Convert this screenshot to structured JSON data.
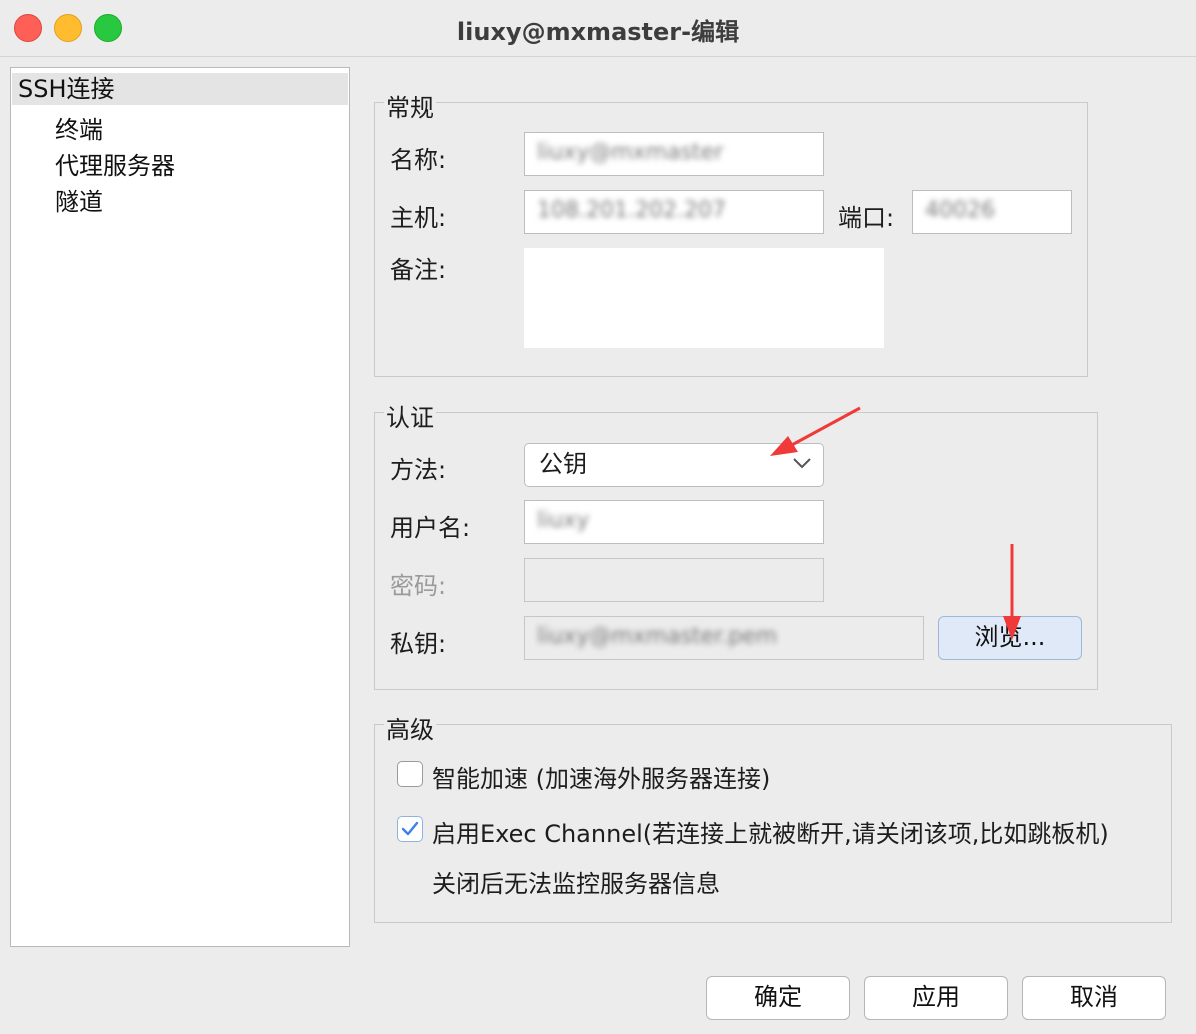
{
  "window": {
    "title": "liuxy@mxmaster-编辑"
  },
  "sidebar": {
    "items": [
      {
        "label": "SSH连接",
        "selected": true
      },
      {
        "label": "终端"
      },
      {
        "label": "代理服务器"
      },
      {
        "label": "隧道"
      }
    ]
  },
  "general": {
    "title": "常规",
    "name_label": "名称:",
    "name_value": "liuxy@mxmaster",
    "host_label": "主机:",
    "host_value": "108.201.202.207",
    "port_label": "端口:",
    "port_value": "40026",
    "note_label": "备注:",
    "note_value": ""
  },
  "auth": {
    "title": "认证",
    "method_label": "方法:",
    "method_value": "公钥",
    "username_label": "用户名:",
    "username_value": "liuxy",
    "password_label": "密码:",
    "password_value": "",
    "privatekey_label": "私钥:",
    "privatekey_value": "liuxy@mxmaster.pem",
    "browse_label": "浏览..."
  },
  "advanced": {
    "title": "高级",
    "accel_label": "智能加速 (加速海外服务器连接)",
    "accel_checked": false,
    "exec_label": "启用Exec Channel(若连接上就被断开,请关闭该项,比如跳板机)",
    "exec_checked": true,
    "exec_note": "关闭后无法监控服务器信息"
  },
  "buttons": {
    "ok": "确定",
    "apply": "应用",
    "cancel": "取消"
  },
  "colors": {
    "accent": "#3b82e6",
    "annotation_arrow": "#f03a3a"
  },
  "icons": {
    "dropdown": "chevron-down-icon",
    "check": "checkmark-icon"
  }
}
